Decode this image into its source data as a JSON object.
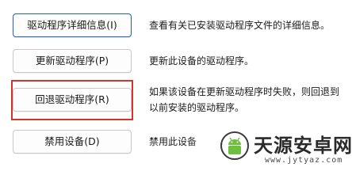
{
  "actions": [
    {
      "button": "驱动程序详细信息(I)",
      "description": [
        "查看有关已安装驱动程序文件的详细信息。"
      ]
    },
    {
      "button": "更新驱动程序(P)",
      "description": [
        "更新此设备的驱动程序。"
      ]
    },
    {
      "button": "回退驱动程序(R)",
      "description": [
        "如果该设备在更新驱动程序时失败，则回退到",
        "以前安装的驱动程序。"
      ]
    },
    {
      "button": "禁用设备(D)",
      "description": [
        "禁用此设备"
      ]
    }
  ],
  "highlight_color": "#d3342b",
  "focus_color": "#1f5fbf",
  "watermark": {
    "name": "天源安卓网",
    "url": "www.jytyaz.com",
    "icon": "android-robot-icon"
  }
}
